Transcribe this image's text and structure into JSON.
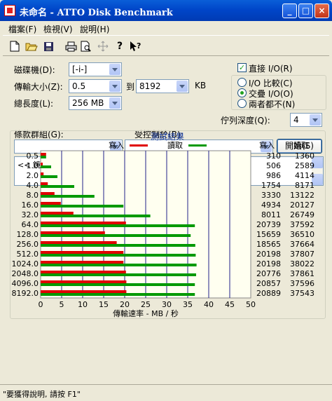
{
  "window": {
    "title": "未命名 - ATTO Disk Benchmark"
  },
  "menu": [
    "檔案(F)",
    "檢視(V)",
    "說明(H)"
  ],
  "toolbar_icons": [
    "new-icon",
    "open-icon",
    "save-icon",
    "print-icon",
    "print-preview-icon",
    "move-icon",
    "help-icon",
    "context-help-icon"
  ],
  "form": {
    "drive_label": "磁碟機(D):",
    "drive_value": "[-i-]",
    "transfer_label": "傳輸大小(Z):",
    "transfer_from": "0.5",
    "to_label": "到",
    "transfer_to": "8192",
    "unit": "KB",
    "length_label": "總長度(L):",
    "length_value": "256 MB",
    "direct_io_label": "直接 I/O(R)",
    "direct_io_checked": true,
    "io_compare": "I/O 比較(C)",
    "overlapped_io": "交疊 I/O(O)",
    "neither": "兩者都不(N)",
    "queue_label": "佇列深度(Q):",
    "queue_value": "4",
    "group_label": "條款群組(G):",
    "controlled_label": "受控制於(B):",
    "start_button": "開始(S)",
    "log_text": "<< 鏡扵 >>"
  },
  "chart_data": {
    "type": "bar",
    "title": "測試結果",
    "legend": {
      "write": "寫入",
      "read": "讀取"
    },
    "column_headers": {
      "write": "寫入",
      "read": "讀取"
    },
    "xlabel": "傳輸速率 - MB / 秒",
    "xlim": [
      0,
      50
    ],
    "xticks": [
      "0",
      "5",
      "10",
      "15",
      "20",
      "25",
      "30",
      "35",
      "40",
      "45",
      "50"
    ],
    "categories": [
      "0.5",
      "1.0",
      "2.0",
      "4.0",
      "8.0",
      "16.0",
      "32.0",
      "64.0",
      "128.0",
      "256.0",
      "512.0",
      "1024.0",
      "2048.0",
      "4096.0",
      "8192.0"
    ],
    "series": [
      {
        "name": "寫入",
        "color": "#e00000",
        "values": [
          1.3,
          0.5,
          0.7,
          1.7,
          3.3,
          4.8,
          7.8,
          20.3,
          15.3,
          18.1,
          19.7,
          19.7,
          20.3,
          20.4,
          20.4
        ],
        "labels": [
          "310",
          "506",
          "986",
          "1754",
          "3330",
          "4934",
          "8011",
          "20739",
          "15659",
          "18565",
          "20198",
          "20198",
          "20776",
          "20857",
          "20889"
        ]
      },
      {
        "name": "讀取",
        "color": "#009900",
        "values": [
          1.3,
          2.5,
          4.0,
          8.0,
          12.8,
          19.7,
          26.1,
          36.7,
          35.7,
          36.8,
          36.9,
          37.1,
          37.0,
          36.7,
          36.7
        ],
        "labels": [
          "1360",
          "2589",
          "4114",
          "8171",
          "13122",
          "20127",
          "26749",
          "37592",
          "36510",
          "37664",
          "37807",
          "38022",
          "37861",
          "37596",
          "37543"
        ]
      }
    ]
  },
  "status": {
    "text": "\"要獲得說明, 請按 F1\""
  }
}
